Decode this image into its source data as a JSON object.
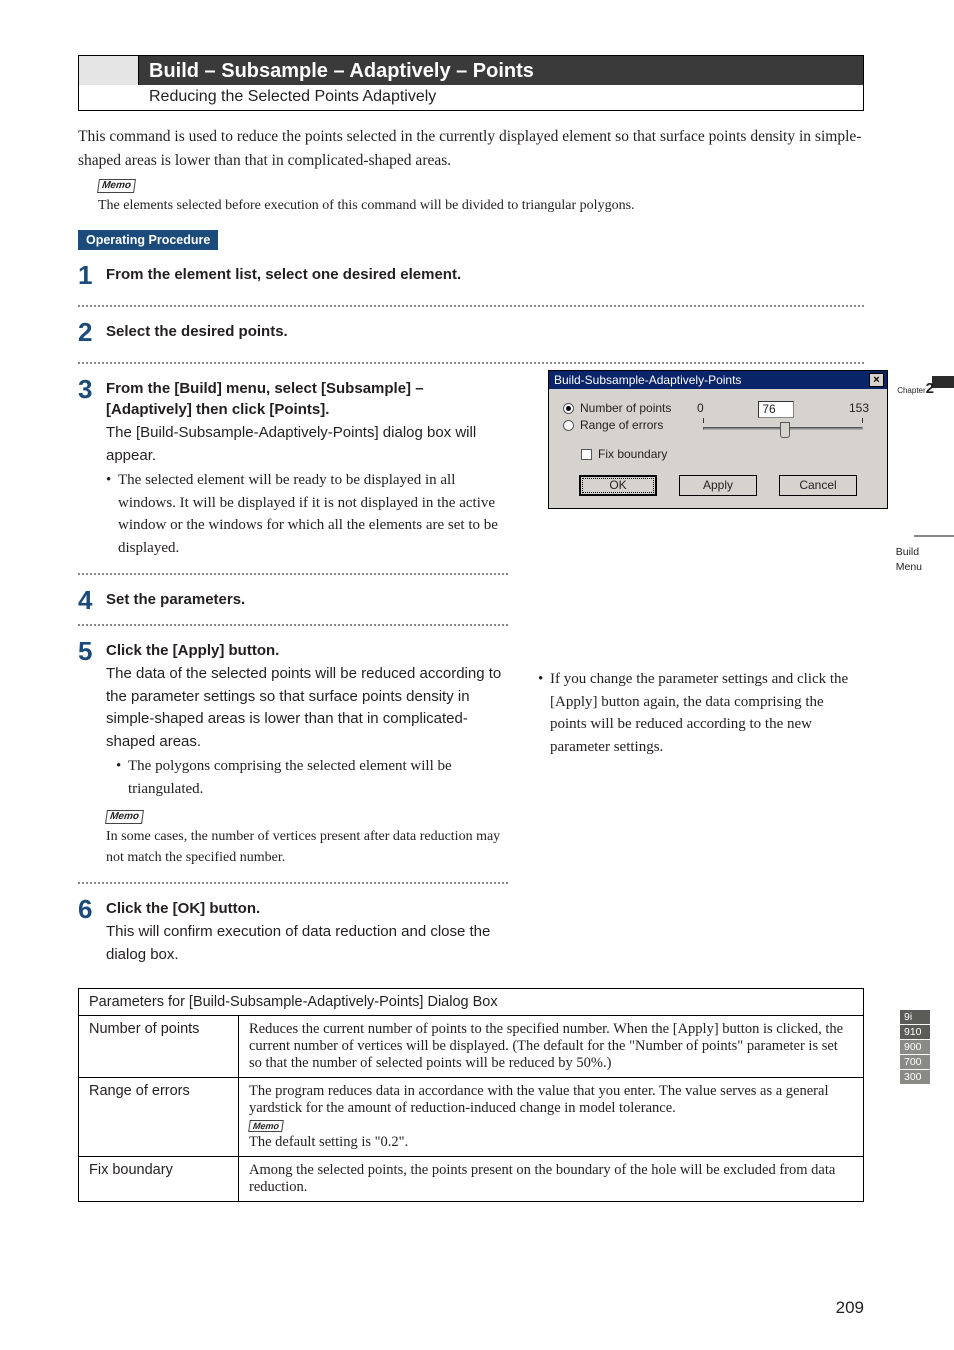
{
  "header": {
    "title": "Build – Subsample – Adaptively – Points",
    "subtitle": "Reducing the Selected Points Adaptively"
  },
  "intro": "This command is used to reduce the points selected in the currently displayed element so that surface points density in simple-shaped areas is lower than that in complicated-shaped areas.",
  "memo_label": "Memo",
  "intro_memo": "The elements selected before execution of this command will be divided to triangular polygons.",
  "op_proc": "Operating Procedure",
  "steps": {
    "s1": {
      "num": "1",
      "head": "From the element list, select one  desired element."
    },
    "s2": {
      "num": "2",
      "head": "Select the desired points."
    },
    "s3": {
      "num": "3",
      "head": "From the [Build] menu, select [Subsam­ple] –[Adaptively] then click [Points].",
      "body": "The [Build-Subsample-Adaptively-Points] dia­log box will appear.",
      "bullet": "The selected element will be ready to be displayed in all windows. It will be displayed if it is not dis­played in the active window or the windows for which all the elements are set to be displayed."
    },
    "s4": {
      "num": "4",
      "head": "Set the parameters."
    },
    "s5": {
      "num": "5",
      "head": "Click the [Apply] button.",
      "body": "The data of the selected points will be reduced according to the parameter settings so that surface points density in simple-shaped areas is lower than that in complicated-shaped areas.",
      "bullet": "The polygons comprising the selected element will be triangulated.",
      "memo": "In some cases, the number of vertices present after data reduction may not match the specified number.",
      "right_bullet": "If you change the parameter settings and click the [Apply] button again, the data comprising the points will be reduced according to the new parameter settings."
    },
    "s6": {
      "num": "6",
      "head": "Click the [OK] button.",
      "body": "This will confirm execution of data reduction and close the dialog box."
    }
  },
  "dialog": {
    "title": "Build-Subsample-Adaptively-Points",
    "opt1": "Number of points",
    "opt2": "Range of errors",
    "value": "76",
    "min": "0",
    "max": "153",
    "fix": "Fix boundary",
    "ok": "OK",
    "apply": "Apply",
    "cancel": "Cancel"
  },
  "side": {
    "chapter_label": "Chapter",
    "chapter_num": "2",
    "menu1": "Build",
    "menu2": "Menu",
    "models": [
      "9i",
      "910",
      "900",
      "700",
      "300"
    ]
  },
  "table": {
    "caption": "Parameters for [Build-Subsample-Adaptively-Points] Dialog Box",
    "rows": [
      {
        "name": "Number of points",
        "desc": "Reduces the current number of points to the specified number. When the [Apply] button is clicked, the current number of vertices will be displayed. (The default for the \"Number of points\" param­eter is set so that the number of selected points will be reduced by 50%.)"
      },
      {
        "name": "Range of errors",
        "desc_pre": "The program reduces data in accordance with the value that you enter. The value serves as a gen­eral yardstick for the amount of reduction-induced change in model tolerance.",
        "desc_post": "The default setting is \"0.2\"."
      },
      {
        "name": "Fix boundary",
        "desc": "Among the selected points, the points present on the boundary of the hole will be excluded from data reduction."
      }
    ]
  },
  "page_number": "209"
}
